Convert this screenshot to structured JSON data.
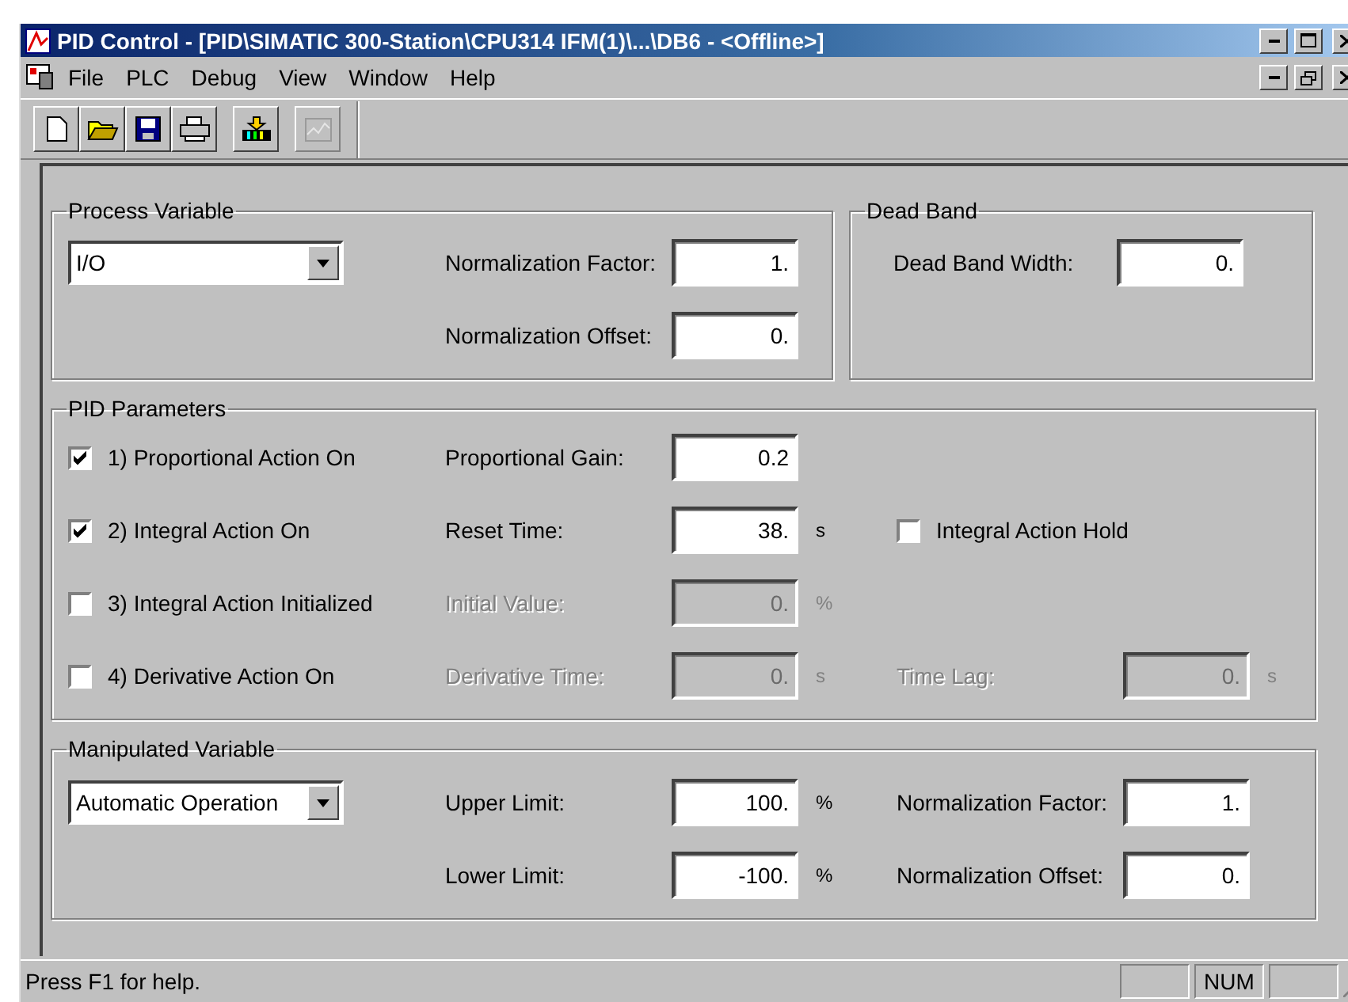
{
  "window": {
    "title": "PID Control - [PID\\SIMATIC 300-Station\\CPU314 IFM(1)\\...\\DB6 - <Offline>]"
  },
  "menu": [
    "File",
    "PLC",
    "Debug",
    "View",
    "Window",
    "Help"
  ],
  "toolbar": [
    {
      "kind": "new",
      "disabled": false
    },
    {
      "kind": "open",
      "disabled": false
    },
    {
      "kind": "save",
      "disabled": false
    },
    {
      "kind": "print",
      "disabled": false
    },
    {
      "kind": "download",
      "disabled": false
    },
    {
      "kind": "curve",
      "disabled": true
    }
  ],
  "process_variable": {
    "title": "Process Variable",
    "dropdown": "I/O",
    "fields": [
      {
        "label": "Normalization Factor:",
        "value": "1."
      },
      {
        "label": "Normalization Offset:",
        "value": "0."
      }
    ]
  },
  "dead_band": {
    "title": "Dead Band",
    "fields": [
      {
        "label": "Dead Band Width:",
        "value": "0."
      }
    ]
  },
  "pid_parameters": {
    "title": "PID Parameters",
    "rows": [
      {
        "check": {
          "label": "1) Proportional Action On",
          "checked": true
        },
        "field": {
          "label": "Proportional Gain:",
          "value": "0.2",
          "disabled": false
        }
      },
      {
        "check": {
          "label": "2) Integral Action On",
          "checked": true
        },
        "field": {
          "label": "Reset Time:",
          "value": "38.",
          "unit": "s",
          "disabled": false
        },
        "extra": {
          "kind": "checkbox",
          "label": "Integral Action Hold",
          "checked": false
        }
      },
      {
        "check": {
          "label": "3) Integral Action Initialized",
          "checked": false
        },
        "field": {
          "label": "Initial Value:",
          "value": "0.",
          "unit": "%",
          "disabled": true
        }
      },
      {
        "check": {
          "label": "4) Derivative Action On",
          "checked": false
        },
        "field": {
          "label": "Derivative Time:",
          "value": "0.",
          "unit": "s",
          "disabled": true
        },
        "extra": {
          "kind": "field",
          "label": "Time Lag:",
          "value": "0.",
          "unit": "s",
          "disabled": true
        }
      }
    ]
  },
  "manipulated_variable": {
    "title": "Manipulated Variable",
    "dropdown": "Automatic Operation",
    "rows": [
      [
        {
          "label": "Upper Limit:",
          "value": "100.",
          "unit": "%"
        },
        {
          "label": "Normalization Factor:",
          "value": "1."
        }
      ],
      [
        {
          "label": "Lower Limit:",
          "value": "-100.",
          "unit": "%"
        },
        {
          "label": "Normalization Offset:",
          "value": "0."
        }
      ]
    ]
  },
  "status_bar": {
    "text": "Press F1 for help.",
    "indicator": "NUM"
  }
}
